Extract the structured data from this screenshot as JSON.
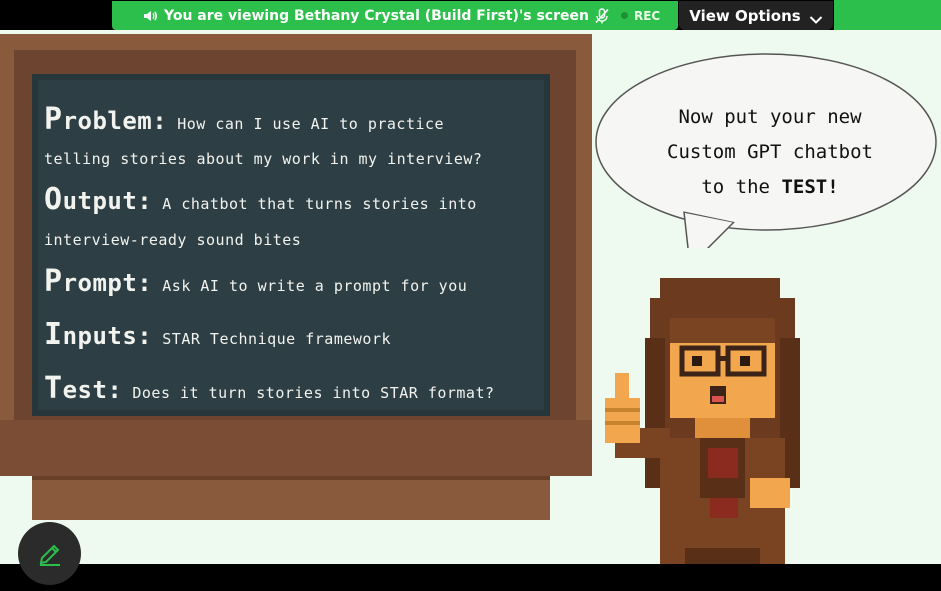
{
  "share_bar": {
    "viewing_text": "You are viewing  Bethany Crystal (Build First)'s screen",
    "rec_label": "REC",
    "view_options_label": "View Options"
  },
  "slide": {
    "board": {
      "items": [
        {
          "key_first": "P",
          "key_rest": "roblem:",
          "value": "How can I use AI to practice",
          "continuation": "telling stories about my work in my interview?"
        },
        {
          "key_first": "O",
          "key_rest": "utput:",
          "value": "A chatbot that turns stories into",
          "continuation": "interview-ready sound bites"
        },
        {
          "key_first": "P",
          "key_rest": "rompt:",
          "value": "Ask AI to write a prompt for you",
          "continuation": ""
        },
        {
          "key_first": "I",
          "key_rest": "nputs:",
          "value": "STAR Technique framework",
          "continuation": ""
        },
        {
          "key_first": "T",
          "key_rest": "est:",
          "value": "Does it turn stories into STAR format?",
          "continuation": ""
        }
      ]
    },
    "bubble": {
      "line1": "Now put your new",
      "line2": "Custom GPT chatbot",
      "line3_prefix": "to the ",
      "line3_strong": "TEST!"
    }
  },
  "colors": {
    "banner_green": "#2dbf4b",
    "board": "#2d3f44",
    "frame": "#8a5a3c",
    "slide_bg": "#eefaef"
  },
  "icons": [
    "speaker-icon",
    "mic-muted-icon",
    "rec-dot-icon",
    "chevron-down-icon",
    "pencil-icon"
  ]
}
